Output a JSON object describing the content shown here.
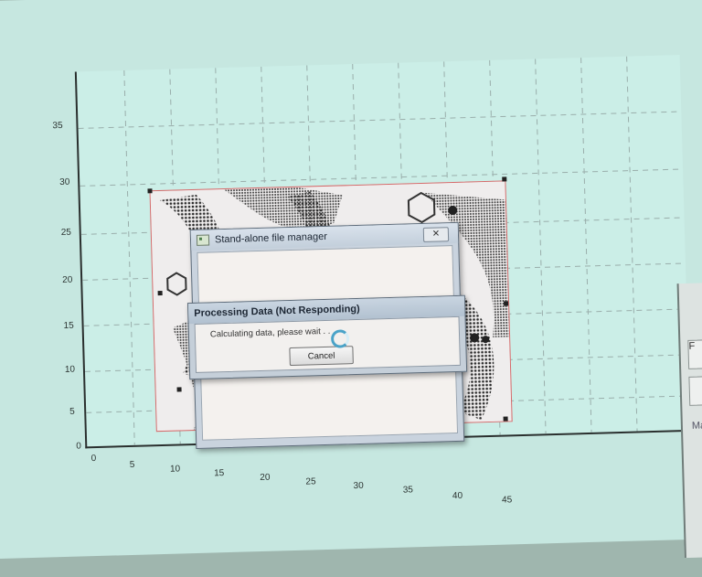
{
  "plot": {
    "y_ticks": [
      "35",
      "30",
      "25",
      "20",
      "15",
      "10",
      "5",
      "0"
    ],
    "x_ticks": [
      "0",
      "5",
      "10",
      "15",
      "20",
      "25",
      "30",
      "35",
      "40",
      "45"
    ]
  },
  "right_panel": {
    "button_1_label": "F",
    "button_2_label": "",
    "label_ma": "Ma"
  },
  "file_manager": {
    "title": "Stand-alone file manager",
    "close_symbol": "✕"
  },
  "processing_dialog": {
    "title": "Processing Data (Not Responding)",
    "message": "Calculating data, please wait . . .",
    "cancel_label": "Cancel"
  }
}
